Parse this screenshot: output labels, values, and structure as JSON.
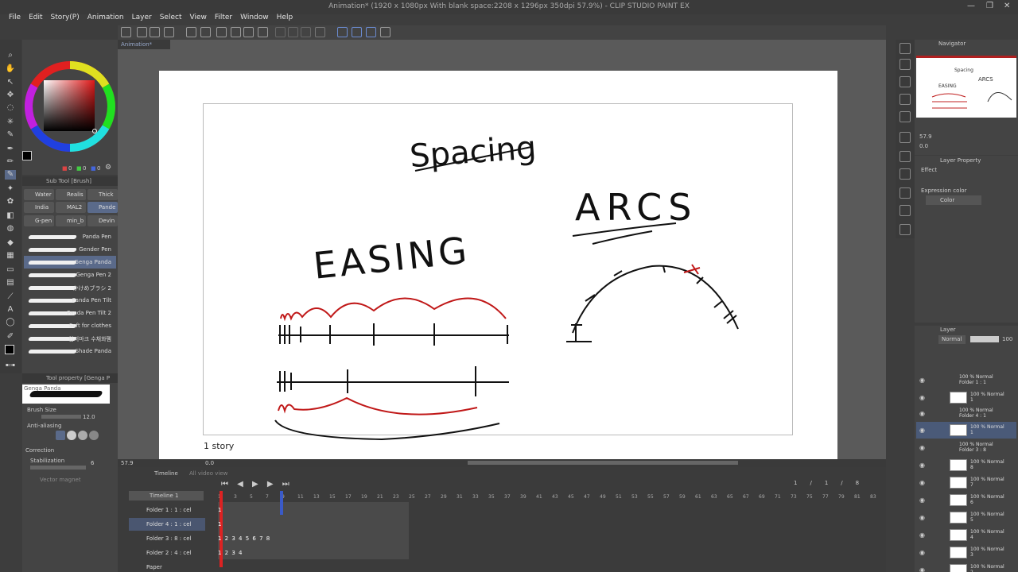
{
  "window": {
    "title": "Animation* (1920 x 1080px With blank space:2208 x 1296px 350dpi 57.9%) - CLIP STUDIO PAINT EX",
    "min": "—",
    "max": "❐",
    "close": "✕"
  },
  "menu": [
    "File",
    "Edit",
    "Story(P)",
    "Animation",
    "Layer",
    "Select",
    "View",
    "Filter",
    "Window",
    "Help"
  ],
  "document_tab": "Animation*",
  "canvas": {
    "story_label": "1 story",
    "drawing_texts": {
      "spacing": "Spacing",
      "arcs": "ARCS",
      "easing": "EASING"
    }
  },
  "color_panel": {
    "r": "0",
    "g": "0",
    "b": "0"
  },
  "subtool": {
    "header": "Sub Tool [Brush]",
    "tabs": [
      "Water",
      "Realis",
      "Thick",
      "India",
      "MAL2",
      "Pande",
      "G-pen",
      "min_b",
      "Devin"
    ],
    "brushes": [
      "Panda Pen",
      "Gender Pen",
      "Genga Panda",
      "Genga Pen 2",
      "かけめブラシ 2",
      "Panda Pen Tilt",
      "Panda Pen Tilt 2",
      "Soft for clothes",
      "입저마크 수채화펨",
      "Shade Panda"
    ],
    "selected_brush": 2
  },
  "tool_property": {
    "header": "Tool property [Genga P",
    "brush_name": "Genga Panda",
    "brush_size_label": "Brush Size",
    "brush_size_value": "12.0",
    "antialias_label": "Anti-aliasing",
    "correction_label": "Correction",
    "stabilization_label": "Stabilization",
    "stabilization_value": "6",
    "vector_magnet_label": "Vector magnet"
  },
  "status": {
    "zoom": "57.9",
    "rotation": "0.0"
  },
  "timeline": {
    "tab": "Timeline",
    "tab2": "All video view",
    "name": "Timeline 1",
    "frame_readout": [
      "1",
      "/",
      "1",
      "/",
      "8"
    ],
    "frame_numbers": [
      "1",
      "3",
      "5",
      "7",
      "9",
      "11",
      "13",
      "15",
      "17",
      "19",
      "21",
      "23",
      "25",
      "27",
      "29",
      "31",
      "33",
      "35",
      "37",
      "39",
      "41",
      "43",
      "45",
      "47",
      "49",
      "51",
      "53",
      "55",
      "57",
      "59",
      "61",
      "63",
      "65",
      "67",
      "69",
      "71",
      "73",
      "75",
      "77",
      "79",
      "81",
      "83"
    ],
    "tracks": [
      {
        "label": "Folder 1 : 1 : cel",
        "cels": "1"
      },
      {
        "label": "Folder 4 : 1 : cel",
        "cels": "1"
      },
      {
        "label": "Folder 3 : 8 : cel",
        "cels": "1 2 3 4 5 6 7 8"
      },
      {
        "label": "Folder 2 : 4 : cel",
        "cels": "1 2 3 4"
      },
      {
        "label": "Paper",
        "cels": ""
      }
    ]
  },
  "navigator": {
    "header": "Navigator",
    "zoom": "57.9",
    "rotation": "0.0"
  },
  "layer_property": {
    "header": "Layer Property",
    "effect_label": "Effect",
    "expression_label": "Expression color",
    "expression_value": "Color"
  },
  "layer_panel": {
    "header": "Layer",
    "blend_mode": "Normal",
    "opacity": "100",
    "layers": [
      {
        "kind": "folder",
        "line1": "100 % Normal",
        "line2": "Folder 1 : 1"
      },
      {
        "kind": "layer",
        "line1": "100 % Normal",
        "line2": "1"
      },
      {
        "kind": "folder",
        "line1": "100 % Normal",
        "line2": "Folder 4 : 1"
      },
      {
        "kind": "layer",
        "line1": "100 % Normal",
        "line2": "1",
        "selected": true
      },
      {
        "kind": "folder",
        "line1": "100 % Normal",
        "line2": "Folder 3 : 8"
      },
      {
        "kind": "layer",
        "line1": "100 % Normal",
        "line2": "8"
      },
      {
        "kind": "layer",
        "line1": "100 % Normal",
        "line2": "7"
      },
      {
        "kind": "layer",
        "line1": "100 % Normal",
        "line2": "6"
      },
      {
        "kind": "layer",
        "line1": "100 % Normal",
        "line2": "5"
      },
      {
        "kind": "layer",
        "line1": "100 % Normal",
        "line2": "4"
      },
      {
        "kind": "layer",
        "line1": "100 % Normal",
        "line2": "3"
      },
      {
        "kind": "layer",
        "line1": "100 % Normal",
        "line2": "2"
      }
    ]
  }
}
